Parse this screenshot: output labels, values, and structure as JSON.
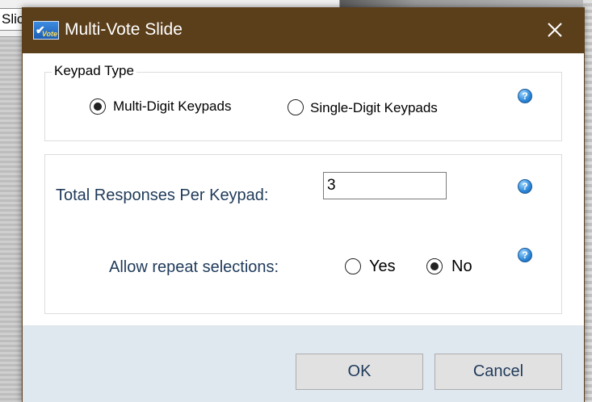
{
  "background": {
    "tab_fragment": "Slic"
  },
  "dialog": {
    "title": "Multi-Vote Slide",
    "app_icon_text": "Vote",
    "close_glyph": "✕",
    "keypad_type": {
      "legend": "Keypad Type",
      "options": [
        {
          "label": "Multi-Digit Keypads",
          "selected": true
        },
        {
          "label": "Single-Digit Keypads",
          "selected": false
        }
      ]
    },
    "total_responses": {
      "label": "Total Responses Per Keypad:",
      "value": "3"
    },
    "allow_repeat": {
      "label": "Allow repeat selections:",
      "options": [
        {
          "label": "Yes",
          "selected": false
        },
        {
          "label": "No",
          "selected": true
        }
      ]
    },
    "help_glyph": "?",
    "buttons": {
      "ok": "OK",
      "cancel": "Cancel"
    }
  },
  "colors": {
    "titlebar": "#5b3f1b",
    "footer": "#dfe7ef",
    "label_text": "#1f3a5a",
    "help_icon": "#2a86d8"
  }
}
